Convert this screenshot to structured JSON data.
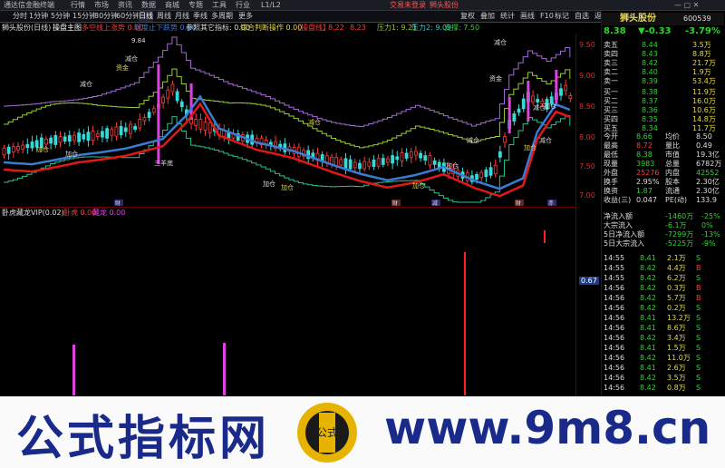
{
  "titlebar": {
    "app": "通达信金融终端",
    "menus": [
      "行情",
      "市场",
      "资讯",
      "数据",
      "商城",
      "专题",
      "工具",
      "行业",
      "L1/L2"
    ],
    "login": "交易未登录",
    "stock_tag": "狮头股份"
  },
  "toolbar": {
    "periods": [
      "分时",
      "1分钟",
      "5分钟",
      "15分钟",
      "30分钟",
      "60分钟",
      "日线",
      "周线",
      "月线",
      "季线",
      "多周期",
      "更多"
    ],
    "right": [
      "复权",
      "叠加",
      "统计",
      "画线",
      "F10",
      "标记",
      "自选",
      "返回"
    ]
  },
  "indicator_bar": {
    "chart_name": "狮头股份(日线)",
    "formula": "操盘主图",
    "t1": "多空线上涨势 0.00",
    "t2": "轻度止下跌势 0.00",
    "t3": "参照其它指标: 0.00",
    "t4": "综合判断操作 0.00",
    "t5": "【操盘线】",
    "t6": "8.22",
    "t7": "8.23",
    "t8": "压力1: 9.21",
    "t9": "压力2: 9.09",
    "t10": "支撑: 7.50"
  },
  "sub_bar": {
    "formula": "卧虎藏龙VIP(0.02)",
    "f1": "卧虎 0.00",
    "f2": "藏龙 0.00"
  },
  "chart_labels": {
    "peak_price": "9.84",
    "labels": [
      "资金",
      "减仓",
      "减仓",
      "加仓",
      "加仓",
      "三羊底",
      "减仓",
      "减仓",
      "加仓",
      "加仓",
      "资金",
      "减仓",
      "加仓",
      "加仓",
      "减仓",
      "加仓",
      "加仓",
      "减仓"
    ],
    "bottom_markers": [
      "财",
      "财",
      "减",
      "财",
      "赤"
    ]
  },
  "price_axis": [
    "9.84",
    "9.50",
    "9.00",
    "8.50",
    "8.00",
    "7.50",
    "7.00",
    "6.50",
    "0.67"
  ],
  "quote": {
    "name": "狮头股份",
    "code": "600539",
    "price": "8.38",
    "change": "▼-0.33",
    "pct": "-3.79%",
    "sells": [
      [
        "卖五",
        "8.44",
        "3.5万"
      ],
      [
        "卖四",
        "8.43",
        "8.8万"
      ],
      [
        "卖三",
        "8.42",
        "21.7万"
      ],
      [
        "卖二",
        "8.40",
        "1.9万"
      ],
      [
        "卖一",
        "8.39",
        "53.4万"
      ]
    ],
    "buys": [
      [
        "买一",
        "8.38",
        "11.9万"
      ],
      [
        "买二",
        "8.37",
        "16.0万"
      ],
      [
        "买三",
        "8.36",
        "10.6万"
      ],
      [
        "买四",
        "8.35",
        "14.8万"
      ],
      [
        "买五",
        "8.34",
        "11.7万"
      ]
    ],
    "stats": [
      [
        "今开",
        "8.66",
        "均价",
        "8.50"
      ],
      [
        "最高",
        "8.72",
        "量比",
        "0.49"
      ],
      [
        "最低",
        "8.38",
        "市值",
        "19.3亿"
      ],
      [
        "现量",
        "3983",
        "总量",
        "6782万"
      ],
      [
        "外盘",
        "25276",
        "内盘",
        "42552"
      ],
      [
        "换手",
        "2.95%",
        "股本",
        "2.30亿"
      ],
      [
        "换资",
        "1.87",
        "流通",
        "2.30亿"
      ],
      [
        "收益(三)",
        "0.047",
        "PE(动)",
        "133.9"
      ]
    ],
    "flows": [
      [
        "净流入额",
        "-1460万",
        "-25%"
      ],
      [
        "大宗流入",
        "-6.1万",
        "0%"
      ],
      [
        "5日净流入额",
        "-7299万",
        "-13%"
      ],
      [
        "5日大宗流入",
        "-5225万",
        "-9%"
      ]
    ],
    "ticks": [
      [
        "14:55",
        "8.41",
        "2.1万",
        "S"
      ],
      [
        "14:55",
        "8.42",
        "4.4万",
        "B"
      ],
      [
        "14:55",
        "8.42",
        "6.2万",
        "S"
      ],
      [
        "14:56",
        "8.42",
        "0.3万",
        "B"
      ],
      [
        "14:56",
        "8.42",
        "5.7万",
        "B"
      ],
      [
        "14:56",
        "8.42",
        "0.2万",
        "S"
      ],
      [
        "14:56",
        "8.41",
        "13.2万",
        "S"
      ],
      [
        "14:56",
        "8.41",
        "8.6万",
        "S"
      ],
      [
        "14:56",
        "8.42",
        "3.4万",
        "S"
      ],
      [
        "14:56",
        "8.41",
        "1.5万",
        "S"
      ],
      [
        "14:56",
        "8.42",
        "11.0万",
        "S"
      ],
      [
        "14:56",
        "8.41",
        "2.6万",
        "S"
      ],
      [
        "14:56",
        "8.42",
        "3.5万",
        "S"
      ],
      [
        "14:56",
        "8.42",
        "0.8万",
        "S"
      ]
    ]
  },
  "banner": {
    "left_text": "公式指标网",
    "right_text": "www.9m8.cn",
    "logo_text": "公式"
  },
  "colors": {
    "up": "#ff3b3b",
    "down": "#2bd82b",
    "ma_blue": "#3a7bd5",
    "ma_red": "#e01818",
    "magenta": "#e040e0"
  }
}
